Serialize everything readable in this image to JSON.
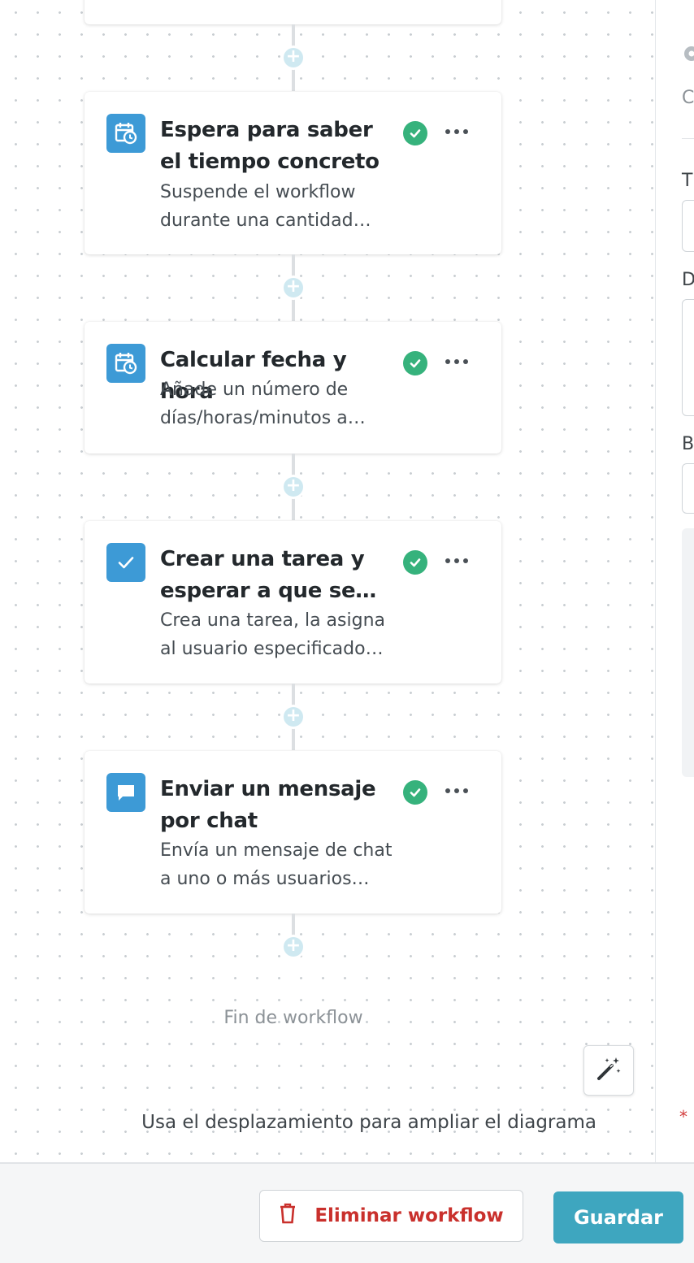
{
  "steps": [
    {
      "title": "Espera para saber el tiempo concreto",
      "description_line1": "Suspende el workflow",
      "description_line2": "durante una cantidad…",
      "icon": "calendar-clock-icon",
      "status": "completed"
    },
    {
      "title": "Calcular fecha y hora",
      "description_line1": "Añade un número de",
      "description_line2": "días/horas/minutos a…",
      "icon": "calendar-clock-icon",
      "status": "completed"
    },
    {
      "title": "Crear una tarea y esperar a que se…",
      "description_line1": "Crea una tarea, la asigna",
      "description_line2": "al usuario especificado…",
      "icon": "checkmark-icon",
      "status": "completed"
    },
    {
      "title": "Enviar un mensaje por chat",
      "description_line1": "Envía un mensaje de chat",
      "description_line2": "a uno o más usuarios…",
      "icon": "chat-bubble-icon",
      "status": "completed"
    }
  ],
  "end_label": "Fin de workflow",
  "zoom_hint": "Usa el desplazamiento para ampliar el diagrama",
  "side_panel": {
    "labels": [
      "C",
      "T",
      "D",
      "B"
    ],
    "required_marker": "*"
  },
  "footer": {
    "delete_label": "Eliminar workflow",
    "save_label": "Guardar"
  },
  "colors": {
    "accent": "#3ea6bf",
    "icon_bg": "#3d9ad6",
    "success": "#36b27c",
    "danger": "#c9302c"
  }
}
